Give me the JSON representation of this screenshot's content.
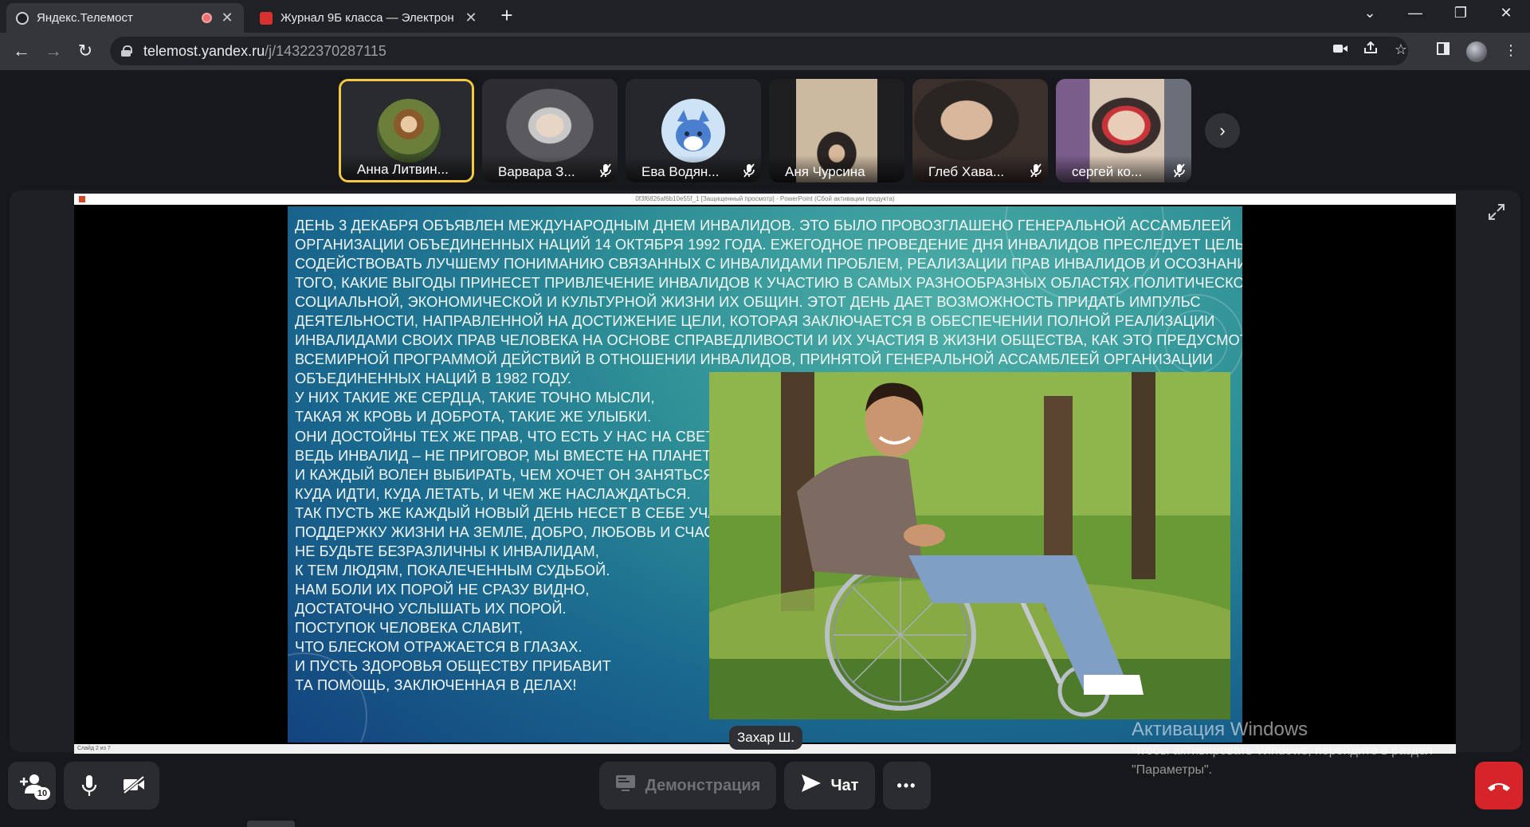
{
  "browser": {
    "tabs": [
      {
        "title": "Яндекс.Телемост",
        "active": true
      },
      {
        "title": "Журнал 9Б класса — Электрон",
        "active": false
      }
    ],
    "url_host": "telemost.yandex.ru",
    "url_path": "/j/14322370287115",
    "icons": {
      "back": "back-arrow-icon",
      "forward": "forward-arrow-icon",
      "reload": "reload-icon",
      "camera": "camera-icon",
      "share": "share-icon",
      "bookmark": "star-icon",
      "sidepanel": "side-panel-icon",
      "profile": "profile-avatar",
      "menu": "kebab-menu-icon"
    },
    "new_tab_glyph": "+",
    "window_controls": {
      "tabsearch": "⌄",
      "minimize": "—",
      "restore": "❐",
      "close": "✕"
    }
  },
  "participants": [
    {
      "name": "Анна Литвин...",
      "muted": false,
      "speaking": true
    },
    {
      "name": "Варвара З...",
      "muted": true,
      "speaking": false
    },
    {
      "name": "Ева Водян...",
      "muted": true,
      "speaking": false
    },
    {
      "name": "Аня Чурсина",
      "muted": false,
      "speaking": false
    },
    {
      "name": "Глеб Хава...",
      "muted": true,
      "speaking": false
    },
    {
      "name": "сергей ко...",
      "muted": true,
      "speaking": false
    }
  ],
  "stage": {
    "speaker_label": "Захар Ш.",
    "powerpoint": {
      "titlebar": "0f3f6826af6b10e55f_1 [Защищенный просмотр] - PowerPoint (Сбой активации продукта)",
      "statusbar": "Слайд 2 из 7"
    },
    "slide_lines": [
      "День 3 декабря объявлен Международным днем инвалидов. Это было провозглашено Генеральной Ассамблеей",
      "Организации Объединенных Наций 14 октября 1992 года. Ежегодное проведение Дня инвалидов преследует цель",
      "содействовать лучшему пониманию связанных с инвалидами проблем, реализации прав инвалидов и осознанию",
      "того, какие выгоды принесет привлечение инвалидов к участию в самых разнообразных областях политической,",
      "социальной, экономической и культурной жизни их общин. Этот день дает возможность придать импульс",
      "деятельности, направленной на достижение цели, которая заключается в обеспечении полной реализации",
      "инвалидами своих прав человека на основе справедливости и их участия в жизни общества, как это предусмотрено",
      "Всемирной программой действий в отношении инвалидов, принятой Генеральной Ассамблеей Организации",
      "Объединенных Наций в 1982 году.",
      "У них такие же сердца, такие точно мысли,",
      "Такая ж кровь и доброта, такие же улыбки.",
      "Они достойны тех же прав, что есть у нас на свете,",
      "Ведь инвалид – не приговор, мы вместе на планете.",
      "И каждый волен выбирать, чем хочет он заняться,",
      "Куда идти, куда летать, и чем же наслаждаться.",
      "Так пусть же каждый новый день несет в себе участье,",
      "Поддержку жизни на земле, добро, любовь и счастье.",
      "Не будьте безразличны к инвалидам,",
      "К тем людям, покалеченным судьбой.",
      "Нам боли их порой не сразу видно,",
      "Достаточно услышать их порой.",
      "Поступок человека славит,",
      "Что блеском отражается в глазах.",
      "И пусть здоровья обществу прибавит",
      "Та помощь, заключенная в делах!"
    ]
  },
  "watermark": {
    "heading": "Активация Windows",
    "line1": "Чтобы активировать Windows, перейдите в раздел",
    "line2": "\"Параметры\"."
  },
  "controls": {
    "participants_count": "10",
    "demo_label": "Демонстрация",
    "chat_label": "Чат",
    "more_label": "•••"
  },
  "colors": {
    "accent_speaking": "#f5c842",
    "hangup": "#d6242a"
  }
}
